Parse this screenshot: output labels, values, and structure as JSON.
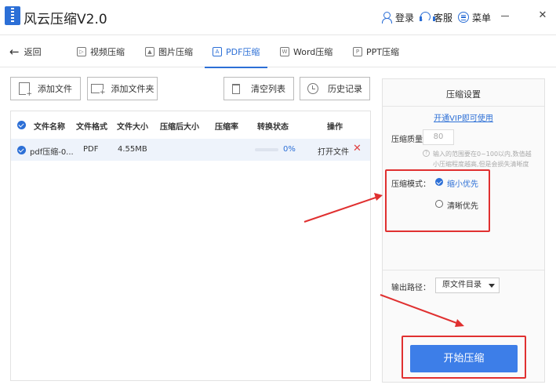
{
  "app": {
    "title": "风云压缩V2.0"
  },
  "titlebar": {
    "login": "登录",
    "service": "客服",
    "menu": "菜单"
  },
  "nav": {
    "back": "返回",
    "tabs": [
      {
        "label": "视频压缩",
        "active": false
      },
      {
        "label": "图片压缩",
        "active": false
      },
      {
        "label": "PDF压缩",
        "active": true
      },
      {
        "label": "Word压缩",
        "active": false
      },
      {
        "label": "PPT压缩",
        "active": false
      }
    ]
  },
  "toolbar": {
    "add_file": "添加文件",
    "add_folder": "添加文件夹",
    "clear_list": "清空列表",
    "history": "历史记录"
  },
  "table": {
    "headers": [
      "文件名称",
      "文件格式",
      "文件大小",
      "压缩后大小",
      "压缩率",
      "转换状态",
      "操作"
    ],
    "rows": [
      {
        "name": "pdf压缩-0...",
        "format": "PDF",
        "size": "4.55MB",
        "compressed_size": "",
        "ratio": "",
        "progress": 0,
        "status": "0%",
        "action": "打开文件",
        "checked": true
      }
    ]
  },
  "settings": {
    "title": "压缩设置",
    "vip_link": "开通VIP即可使用",
    "quality_label": "压缩质量：",
    "quality_value": "80",
    "hint_line1": "输入的范围要在0~100以内,数值越",
    "hint_line2": "小压缩程度越高,但是会损失清晰度",
    "mode_label": "压缩模式：",
    "mode_options": [
      {
        "label": "缩小优先",
        "selected": true
      },
      {
        "label": "清晰优先",
        "selected": false
      }
    ],
    "output_label": "输出路径：",
    "output_value": "原文件目录",
    "start_button": "开始压缩"
  },
  "colors": {
    "accent": "#2c6fd6",
    "annotation": "#e03030"
  }
}
